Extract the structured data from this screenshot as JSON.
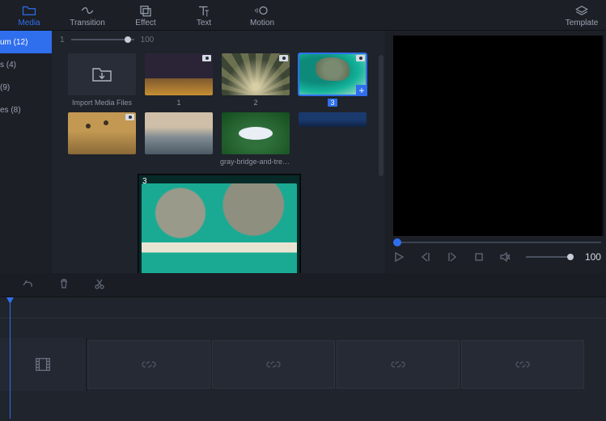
{
  "toolbar": {
    "items": [
      {
        "id": "media",
        "label": "Media",
        "active": true
      },
      {
        "id": "transition",
        "label": "Transition",
        "active": false
      },
      {
        "id": "effect",
        "label": "Effect",
        "active": false
      },
      {
        "id": "text",
        "label": "Text",
        "active": false
      },
      {
        "id": "motion",
        "label": "Motion",
        "active": false
      }
    ],
    "right": {
      "id": "template",
      "label": "Template"
    }
  },
  "sidebar": {
    "items": [
      {
        "label": "um  (12)",
        "active": true
      },
      {
        "label": "s (4)",
        "active": false
      },
      {
        "label": "(9)",
        "active": false
      },
      {
        "label": "es  (8)",
        "active": false
      }
    ]
  },
  "zoom": {
    "min": "1",
    "max": "100"
  },
  "grid": {
    "import_label": "Import Media Files",
    "items": [
      {
        "caption": "1",
        "art": "art-city",
        "video": true,
        "selected": false
      },
      {
        "caption": "2",
        "art": "art-rays",
        "video": true,
        "selected": false
      },
      {
        "caption": "3",
        "art": "art-aerial",
        "video": true,
        "selected": true,
        "sel_caption": true
      },
      {
        "caption": "",
        "art": "art-balloon",
        "video": true,
        "selected": false
      },
      {
        "caption": "",
        "art": "art-mountain",
        "video": false,
        "selected": false
      },
      {
        "caption": "gray-bridge-and-trees...",
        "art": "art-forest",
        "video": false,
        "selected": false
      },
      {
        "caption": "",
        "art": "art-blue",
        "video": false,
        "selected": false
      }
    ]
  },
  "drag": {
    "number": "3"
  },
  "preview": {
    "volume": "100"
  },
  "plus": "+"
}
